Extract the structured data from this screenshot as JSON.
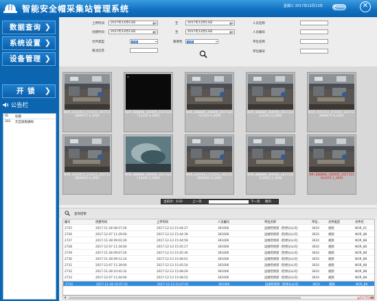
{
  "app": {
    "title": "智能安全帽采集站管理系统",
    "date": "星期三 2017年12月13日",
    "back_label": "Back",
    "close_glyph": "✕"
  },
  "sidebar": {
    "menu": [
      {
        "label": "数据查询",
        "chevron": "❯"
      },
      {
        "label": "系统设置",
        "chevron": "❯"
      },
      {
        "label": "设备管理",
        "chevron": "❯"
      }
    ],
    "lock": {
      "label": "开 锁",
      "chevron": "❯"
    },
    "notice": {
      "icon": "speaker-icon",
      "title": "公告栏",
      "columns": [
        "ID",
        "标题"
      ],
      "rows": [
        {
          "id": "201",
          "title": "元旦放假通知"
        }
      ]
    }
  },
  "filters": {
    "upload_time_label": "上传时间",
    "upload_from": "2017年12月13日",
    "to1": "至",
    "upload_to": "2017年12月13日",
    "create_time_label": "创建时间",
    "create_from": "2017年12月13日",
    "to2": "至",
    "create_to": "2017年12月13日",
    "file_type_label": "文件类型",
    "file_type_value": "全部",
    "importance_label": "重要性",
    "importance_value": "全部",
    "remark_label": "备注信息",
    "remark_value": "",
    "person_name_label": "人员名称",
    "person_name_value": "",
    "person_id_label": "人员编号",
    "person_id_value": "",
    "unit_name_label": "单位名称",
    "unit_name_value": "",
    "unit_id_label": "单位编号",
    "unit_id_value": ""
  },
  "gallery": [
    {
      "caption": "NOR_0101011_511011_2017112808572 6_0001",
      "red": false,
      "scene": "office"
    },
    {
      "caption": "NOR_888888_360006_2017120711220 9_0001",
      "red": false,
      "scene": "dark"
    },
    {
      "caption": "NOR_888888_360006_2017120711443 9_0002",
      "red": false,
      "scene": "office"
    },
    {
      "caption": "NOR_888888_360006_2017121114443 0_0002",
      "red": false,
      "scene": "office"
    },
    {
      "caption": "NOR_0101011_511011_2017112808572 6_0001",
      "red": false,
      "scene": "office"
    },
    {
      "caption": "NOR_0101011_511011_2017112809022 6_0001",
      "red": false,
      "scene": "office"
    },
    {
      "caption": "NOR_888888_360006_2017121114441 5_0001",
      "red": false,
      "scene": "blurred"
    },
    {
      "caption": "NOR_0101011_511011_2017112809022 6_0001",
      "red": false,
      "scene": "office"
    },
    {
      "caption": "NOR_888888_360006_2017121114452 2_0004",
      "red": false,
      "scene": "office"
    },
    {
      "caption": "IMP_888888_360006_2017121314470 1_0001",
      "red": true,
      "scene": "office"
    }
  ],
  "pager": {
    "text": "当前页：1/32",
    "prev": "上一页",
    "next": "下一页",
    "go": "跳页"
  },
  "results": {
    "label": "查询结果",
    "columns": [
      "编号",
      "创建时间",
      "上传时间",
      "人员编号",
      "单位名称",
      "单位...",
      "文件类型",
      "文件名"
    ],
    "rows": [
      [
        "2725",
        "2017-11-28 08:57:26",
        "2017-12-13 15:44:27",
        "361006",
        "运维检修部（检修分公司）",
        "3610",
        "视频",
        "NOR_01"
      ],
      [
        "2726",
        "2017-12-07 11:29:00",
        "2017-12-13 15:44:39",
        "361006",
        "运维检修部（检修分公司）",
        "3610",
        "视频",
        "NOR_88"
      ],
      [
        "2727",
        "2017-11-28 09:02:26",
        "2017-12-13 15:44:59",
        "361006",
        "运维检修部（检修分公司）",
        "3610",
        "视频",
        "NOR_88"
      ],
      [
        "2728",
        "2017-12-07 11:34:00",
        "2017-12-13 15:45:17",
        "361006",
        "运维检修部（检修分公司）",
        "3610",
        "视频",
        "NOR_88"
      ],
      [
        "2729",
        "2017-11-28 09:07:26",
        "2017-12-13 15:45:30",
        "361006",
        "运维检修部（检修分公司）",
        "3610",
        "视频",
        "NOR_88"
      ],
      [
        "2730",
        "2017-11-28 09:12:24",
        "2017-12-13 15:46:01",
        "361006",
        "运维检修部（检修分公司）",
        "3610",
        "视频",
        "NOR_88"
      ],
      [
        "2731",
        "2017-12-07 11:39:00",
        "2017-12-13 15:45:54",
        "361006",
        "运维检修部（检修分公司）",
        "3610",
        "视频",
        "NOR_88"
      ],
      [
        "2732",
        "2017-11-28 10:42:32",
        "2017-12-13 15:48:29",
        "361006",
        "运维检修部（检修分公司）",
        "3610",
        "视频",
        "NOR_88"
      ],
      [
        "2733",
        "2017-12-07 11:44:00",
        "2017-12-13 15:48:52",
        "361006",
        "运维检修部（检修分公司）",
        "3610",
        "视频",
        "NOR_88"
      ],
      [
        "2734",
        "2017-11-28 10:47:33",
        "2017-12-13 15:47:01",
        "361006",
        "运维检修部（检修分公司）",
        "3610",
        "视频",
        "NOR_88"
      ]
    ],
    "selected_index": 9
  },
  "watermark": "@51CTO博客"
}
